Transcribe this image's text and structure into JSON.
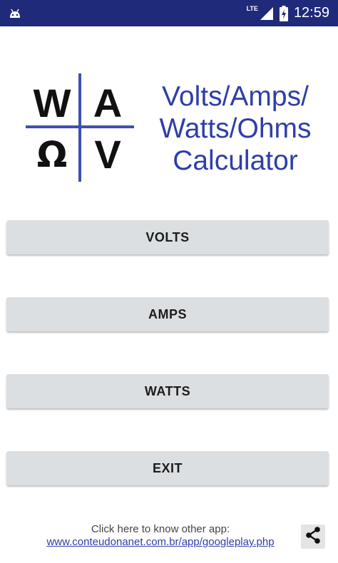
{
  "status_bar": {
    "network_label": "LTE",
    "time": "12:59",
    "background": "#1f2a7a"
  },
  "logo": {
    "top_left": "W",
    "top_right": "A",
    "bottom_left": "Ω",
    "bottom_right": "V",
    "line_color": "#3f4fb3"
  },
  "title": {
    "line1": "Volts/Amps/",
    "line2": "Watts/Ohms",
    "line3": "Calculator",
    "color": "#2f3ea8"
  },
  "menu": {
    "volts_label": "VOLTS",
    "amps_label": "AMPS",
    "watts_label": "WATTS",
    "exit_label": "EXIT",
    "button_color": "#dcdfe1"
  },
  "footer": {
    "prompt": "Click here to know other app:",
    "link_text": "www.conteudonanet.com.br/app/googleplay.php",
    "share_icon": "share-icon"
  }
}
